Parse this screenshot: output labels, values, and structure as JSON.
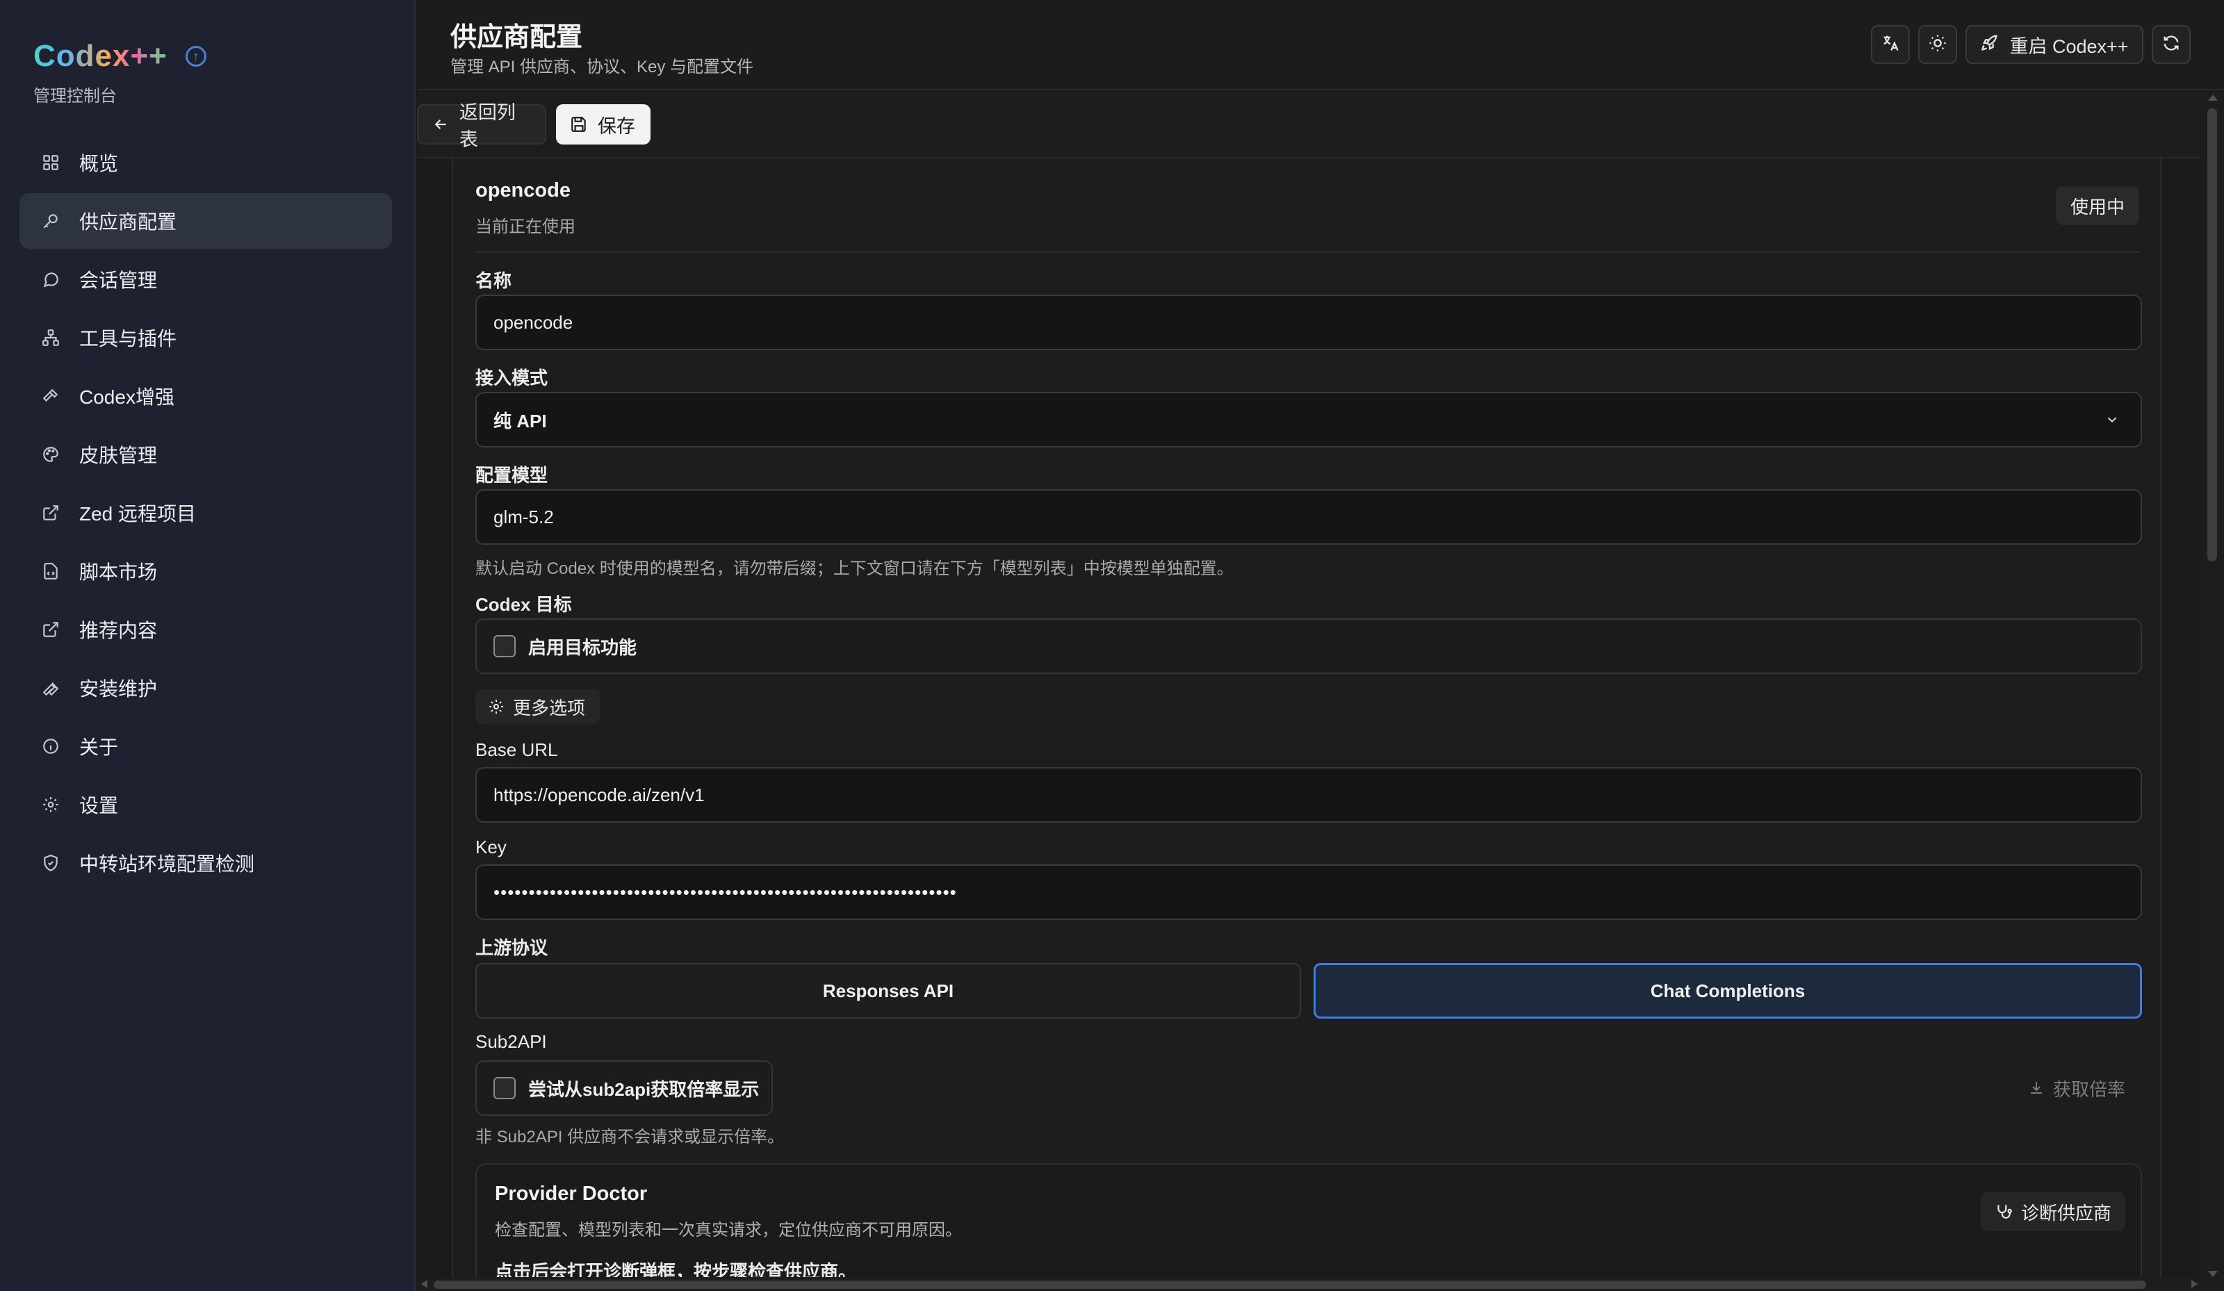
{
  "app": {
    "logo_text": "Codex++",
    "subtitle": "管理控制台"
  },
  "sidebar": {
    "items": [
      {
        "label": "概览",
        "icon": "grid-icon"
      },
      {
        "label": "供应商配置",
        "icon": "key-icon",
        "active": true
      },
      {
        "label": "会话管理",
        "icon": "chat-icon"
      },
      {
        "label": "工具与插件",
        "icon": "network-icon"
      },
      {
        "label": "Codex增强",
        "icon": "hammer-icon"
      },
      {
        "label": "皮肤管理",
        "icon": "palette-icon"
      },
      {
        "label": "Zed 远程项目",
        "icon": "external-link-icon"
      },
      {
        "label": "脚本市场",
        "icon": "file-code-icon"
      },
      {
        "label": "推荐内容",
        "icon": "external-link-icon"
      },
      {
        "label": "安装维护",
        "icon": "wrench-icon"
      },
      {
        "label": "关于",
        "icon": "info-icon"
      },
      {
        "label": "设置",
        "icon": "gear-icon"
      },
      {
        "label": "中转站环境配置检测",
        "icon": "shield-icon"
      }
    ]
  },
  "header": {
    "title": "供应商配置",
    "subtitle": "管理 API 供应商、协议、Key 与配置文件",
    "restart_label": "重启 Codex++"
  },
  "toolbar": {
    "back_label": "返回列表",
    "save_label": "保存"
  },
  "provider": {
    "name": "opencode",
    "state": "当前正在使用",
    "badge": "使用中"
  },
  "form": {
    "name_label": "名称",
    "name_value": "opencode",
    "mode_label": "接入模式",
    "mode_value": "纯 API",
    "model_label": "配置模型",
    "model_value": "glm-5.2",
    "model_hint": "默认启动 Codex 时使用的模型名，请勿带后缀；上下文窗口请在下方「模型列表」中按模型单独配置。",
    "target_label": "Codex 目标",
    "target_checkbox": "启用目标功能",
    "more_options": "更多选项",
    "base_url_label": "Base URL",
    "base_url_value": "https://opencode.ai/zen/v1",
    "key_label": "Key",
    "key_value": "••••••••••••••••••••••••••••••••••••••••••••••••••••••••••••••••••",
    "protocol_label": "上游协议",
    "protocol_options": [
      "Responses API",
      "Chat Completions"
    ],
    "protocol_selected": "Chat Completions",
    "sub2api_label": "Sub2API",
    "sub2api_checkbox": "尝试从sub2api获取倍率显示",
    "fetch_rate": "获取倍率",
    "sub2api_hint": "非 Sub2API 供应商不会请求或显示倍率。"
  },
  "doctor": {
    "title": "Provider Doctor",
    "desc": "检查配置、模型列表和一次真实请求，定位供应商不可用原因。",
    "note": "点击后会打开诊断弹框，按步骤检查供应商。",
    "button": "诊断供应商"
  },
  "colors": {
    "accent": "#3b7de0",
    "sidebar_bg": "#1e2230",
    "main_bg": "#1b1b1b"
  }
}
